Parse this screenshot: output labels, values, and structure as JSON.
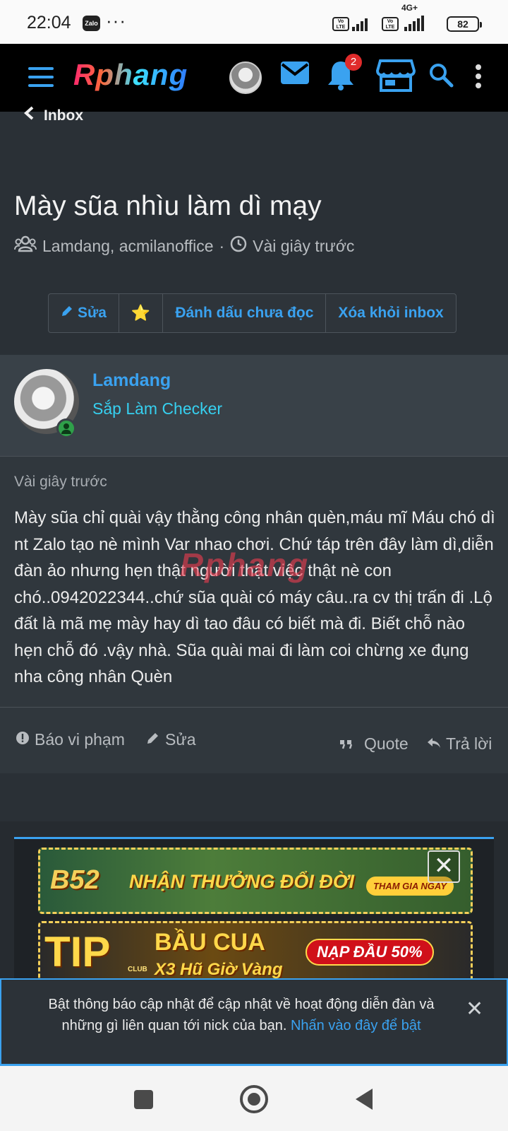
{
  "status_bar": {
    "time": "22:04",
    "notif_icon": "Zalo",
    "overflow": "···",
    "volte_label": "Vo LTE",
    "network_label": "4G+",
    "battery": "82"
  },
  "app_bar": {
    "logo": "Rphang",
    "notification_count": "2",
    "icons": [
      "menu-icon",
      "avatar",
      "mail-icon",
      "bell-icon",
      "store-icon",
      "search-icon",
      "more-vert-icon"
    ]
  },
  "breadcrumb": {
    "label": "Inbox"
  },
  "conversation": {
    "title": "Mày sũa nhìu làm dì mạy",
    "participants": "Lamdang, acmilanoffice",
    "separator": "·",
    "time": "Vài giây trước"
  },
  "toolbar": {
    "edit_label": "Sửa",
    "star_label": "⭐",
    "mark_unread_label": "Đánh dấu chưa đọc",
    "remove_label": "Xóa khỏi inbox"
  },
  "message": {
    "author": "Lamdang",
    "role": "Sắp Làm Checker",
    "time": "Vài giây trước",
    "body": "Mày sũa chỉ quài vậy thằng công nhân quèn,máu mĩ Máu chó dì nt Zalo tạo nè mình Var nhao chơi. Chứ táp trên đây làm dì,diễn đàn ảo nhưng hẹn thật người thật việc thật nè con chó..0942022344..chứ sũa quài có máy câu..ra cv thị trấn đi .Lộ đất là mã mẹ mày hay dì tao đâu có biết mà đi. Biết chỗ nào hẹn chỗ đó .vậy nhà. Sũa quài mai đi làm coi chừng xe đụng nha công nhân Quèn",
    "watermark": "Rphang",
    "actions": {
      "report": "Báo vi phạm",
      "edit": "Sửa",
      "quote": "Quote",
      "reply": "Trả lời"
    }
  },
  "ads": {
    "banner1_brand": "B52",
    "banner1_text": "NHẬN THƯỞNG ĐỔI ĐỜI",
    "banner1_cta": "THAM GIA NGAY",
    "banner2_brand": "TIP",
    "banner2_brand_sub": "CLUB",
    "banner2_text": "BẦU CUA",
    "banner2_sub": "X3 Hũ Giờ Vàng",
    "banner2_cta": "NẠP ĐẦU 50%"
  },
  "notification_banner": {
    "text": "Bật thông báo cập nhật để cập nhật về hoạt động diễn đàn và những gì liên quan tới nick của bạn.",
    "link": "Nhấn vào đây để bật",
    "close": "✕"
  },
  "colors": {
    "accent": "#3aa2f0",
    "role": "#36d0f0",
    "background": "#2a3036",
    "badge": "#e02b2b",
    "online": "#2fa04a"
  }
}
